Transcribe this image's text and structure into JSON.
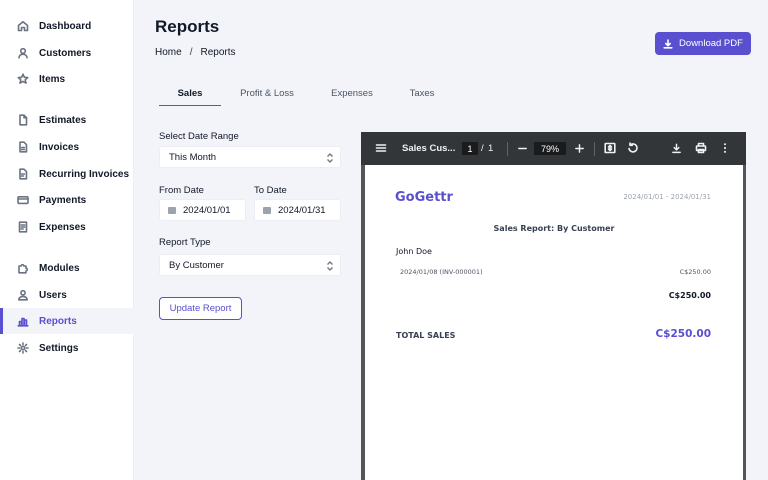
{
  "sidebar": {
    "items": [
      {
        "label": "Dashboard",
        "icon": "home-icon",
        "active": false
      },
      {
        "label": "Customers",
        "icon": "user-icon",
        "active": false
      },
      {
        "label": "Items",
        "icon": "star-icon",
        "active": false
      },
      {
        "label": "Estimates",
        "icon": "document-icon",
        "active": false
      },
      {
        "label": "Invoices",
        "icon": "invoice-icon",
        "active": false
      },
      {
        "label": "Recurring Invoices",
        "icon": "recurring-invoice-icon",
        "active": false
      },
      {
        "label": "Payments",
        "icon": "credit-card-icon",
        "active": false
      },
      {
        "label": "Expenses",
        "icon": "receipt-icon",
        "active": false
      },
      {
        "label": "Modules",
        "icon": "puzzle-icon",
        "active": false
      },
      {
        "label": "Users",
        "icon": "users-icon",
        "active": false
      },
      {
        "label": "Reports",
        "icon": "chart-bar-icon",
        "active": true
      },
      {
        "label": "Settings",
        "icon": "gear-icon",
        "active": false
      }
    ]
  },
  "header": {
    "title": "Reports",
    "breadcrumb": [
      "Home",
      "Reports"
    ],
    "breadcrumb_separator": "/",
    "download_label": "Download PDF"
  },
  "tabs": [
    {
      "label": "Sales",
      "active": true
    },
    {
      "label": "Profit & Loss",
      "active": false
    },
    {
      "label": "Expenses",
      "active": false
    },
    {
      "label": "Taxes",
      "active": false
    }
  ],
  "form": {
    "date_range_label": "Select Date Range",
    "date_range_value": "This Month",
    "from_date_label": "From Date",
    "from_date_value": "2024/01/01",
    "to_date_label": "To Date",
    "to_date_value": "2024/01/31",
    "report_type_label": "Report Type",
    "report_type_value": "By Customer",
    "update_label": "Update Report"
  },
  "viewer": {
    "doc_title": "Sales Cus...",
    "page_current": "1",
    "page_separator": "/",
    "page_total": "1",
    "zoom": "79%",
    "report": {
      "company": "GoGettr",
      "date_range": "2024/01/01 - 2024/01/31",
      "title": "Sales Report: By Customer",
      "customer": "John Doe",
      "line_desc": "2024/01/08 (INV-000001)",
      "line_amount": "C$250.00",
      "subtotal": "C$250.00",
      "total_label": "TOTAL SALES",
      "total_amount": "C$250.00"
    }
  },
  "colors": {
    "accent": "#5a4fcf",
    "background": "#f3f4f9",
    "toolbar": "#323639",
    "viewer_bg": "#525659"
  }
}
